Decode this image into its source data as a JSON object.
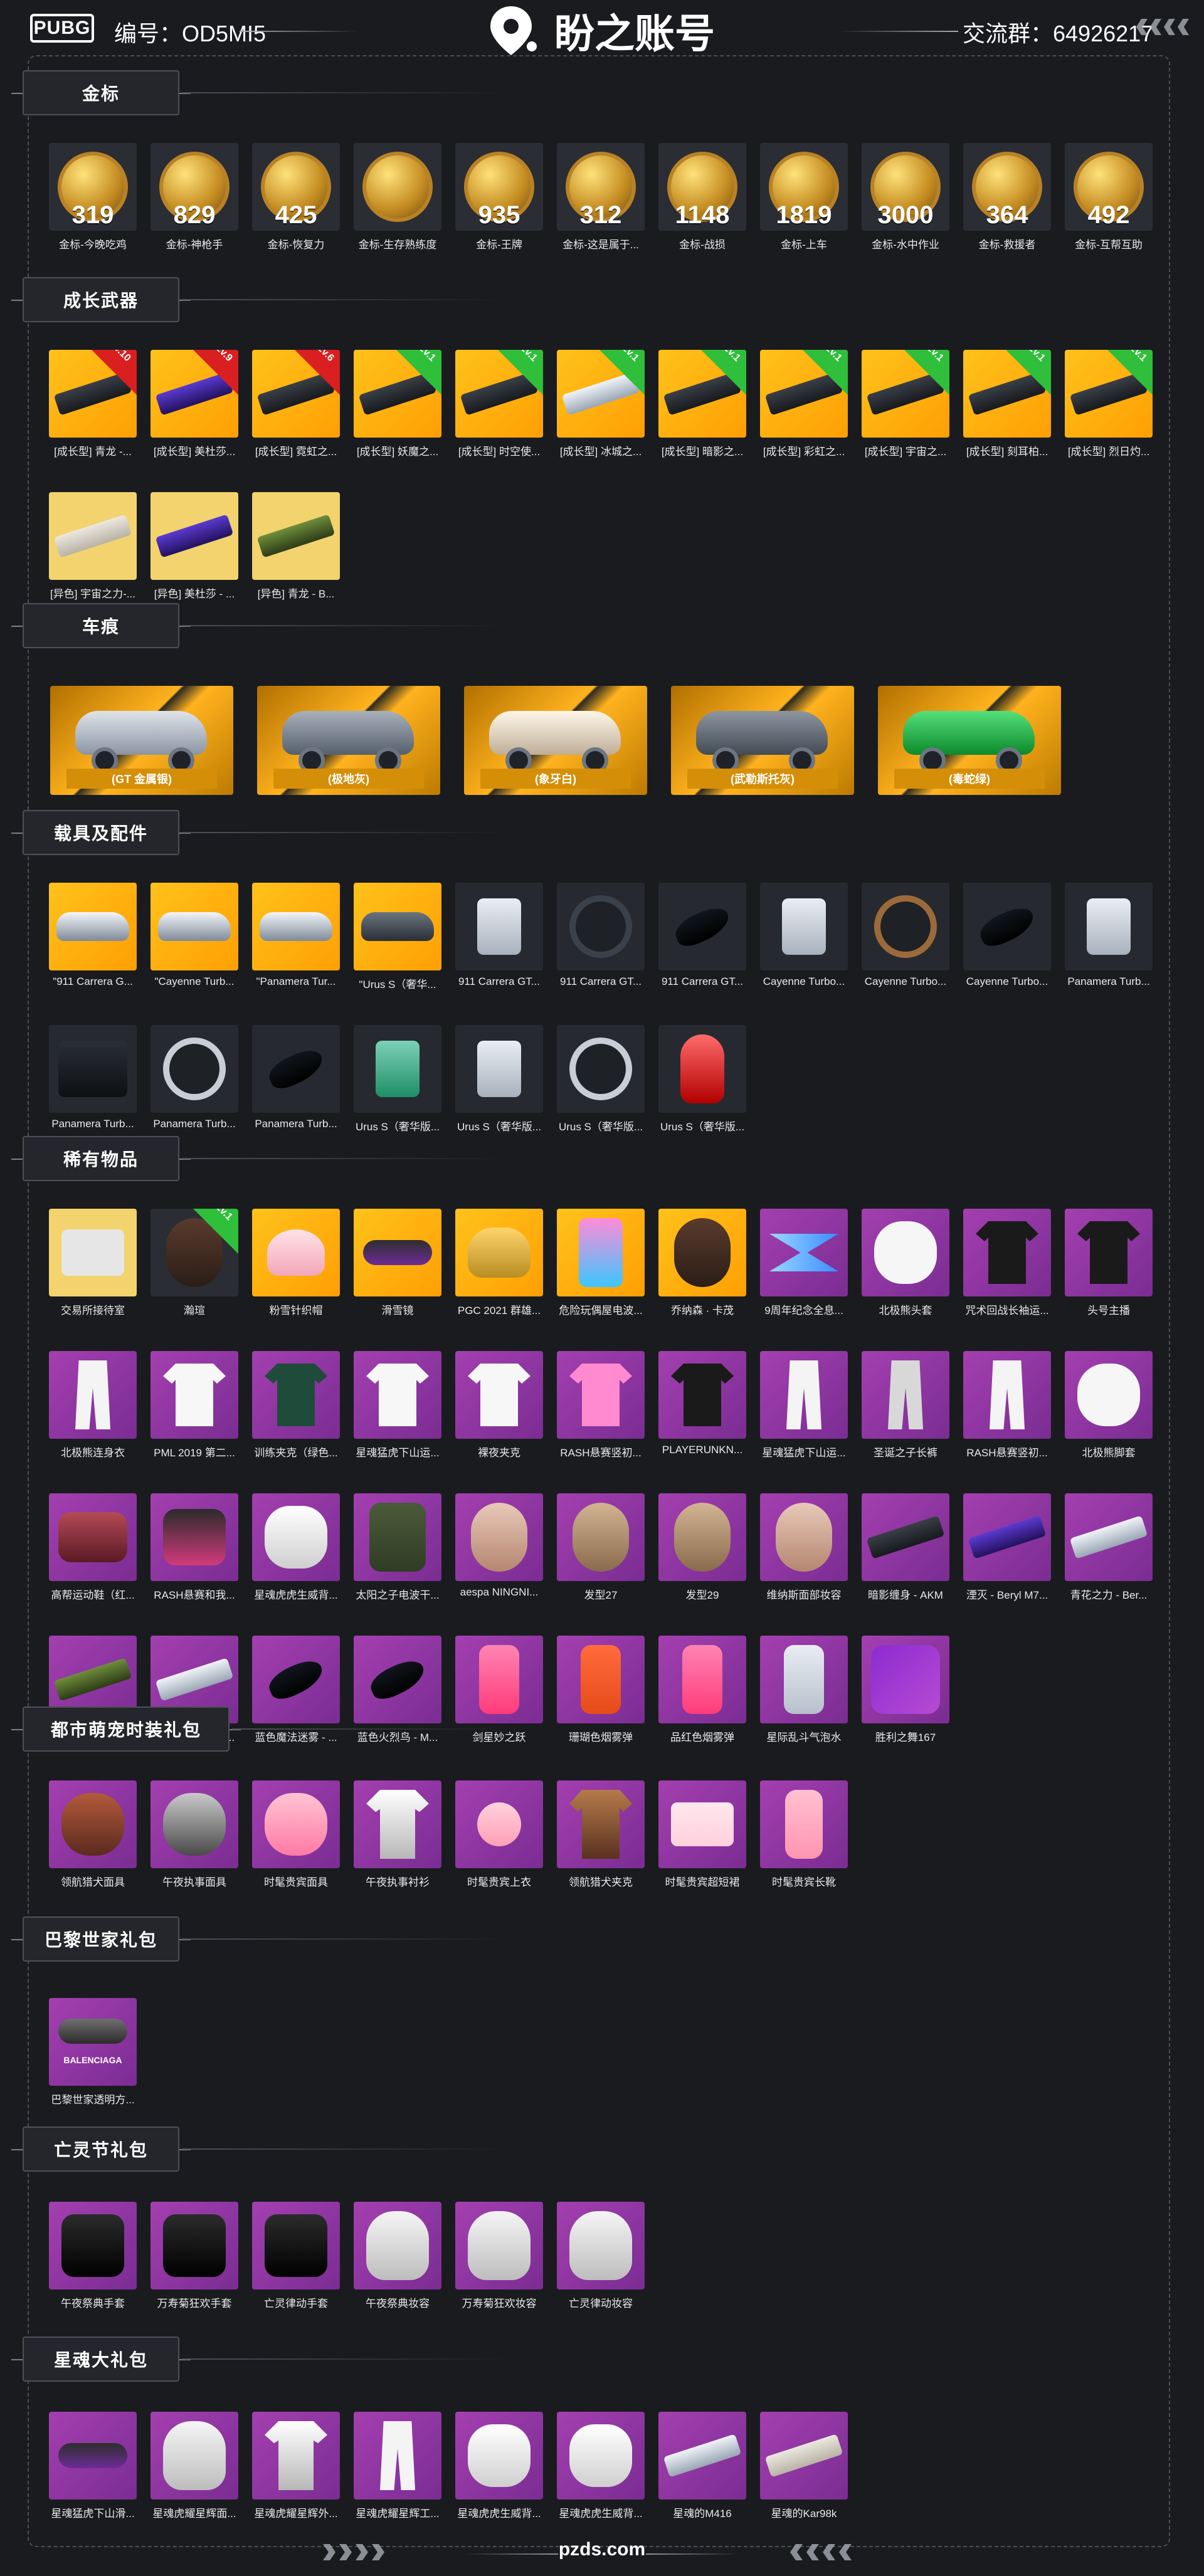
{
  "header": {
    "pubg_logo_text": "PUBG",
    "serial": "编号：OD5MI5",
    "brand_title": "盼之账号",
    "group": "交流群：64926217"
  },
  "sections": {
    "gold_badges": {
      "title": "金标",
      "items": [
        {
          "num": "319",
          "label": "金标-今晚吃鸡"
        },
        {
          "num": "829",
          "label": "金标-神枪手"
        },
        {
          "num": "425",
          "label": "金标-恢复力"
        },
        {
          "num": "",
          "label": "金标-生存熟练度"
        },
        {
          "num": "935",
          "label": "金标-王牌"
        },
        {
          "num": "312",
          "label": "金标-这是属于..."
        },
        {
          "num": "1148",
          "label": "金标-战损"
        },
        {
          "num": "1819",
          "label": "金标-上车"
        },
        {
          "num": "3000",
          "label": "金标-水中作业"
        },
        {
          "num": "364",
          "label": "金标-救援者"
        },
        {
          "num": "492",
          "label": "金标-互帮互助"
        }
      ]
    },
    "growth_weapons": {
      "title": "成长武器",
      "items": [
        {
          "label": "[成长型] 青龙 -...",
          "badge": "Lv.10",
          "badge_color": "red"
        },
        {
          "label": "[成长型] 美杜莎...",
          "badge": "Lv.9",
          "badge_color": "red"
        },
        {
          "label": "[成长型] 霓虹之...",
          "badge": "Lv.6",
          "badge_color": "red"
        },
        {
          "label": "[成长型] 妖魔之...",
          "badge": "Lv.1",
          "badge_color": "green"
        },
        {
          "label": "[成长型] 时空使...",
          "badge": "Lv.1",
          "badge_color": "green"
        },
        {
          "label": "[成长型] 冰城之...",
          "badge": "Lv.1",
          "badge_color": "green"
        },
        {
          "label": "[成长型] 暗影之...",
          "badge": "Lv.1",
          "badge_color": "green"
        },
        {
          "label": "[成长型] 彩虹之...",
          "badge": "Lv.1",
          "badge_color": "green"
        },
        {
          "label": "[成长型] 宇宙之...",
          "badge": "Lv.1",
          "badge_color": "green"
        },
        {
          "label": "[成长型] 刻耳柏...",
          "badge": "Lv.1",
          "badge_color": "green"
        },
        {
          "label": "[成长型] 烈日灼...",
          "badge": "Lv.1",
          "badge_color": "green"
        },
        {
          "label": "[异色] 宇宙之力-...",
          "badge": "",
          "badge_color": ""
        },
        {
          "label": "[异色] 美杜莎 - ...",
          "badge": "",
          "badge_color": ""
        },
        {
          "label": "[异色] 青龙 - B...",
          "badge": "",
          "badge_color": ""
        }
      ]
    },
    "vehicles": {
      "title": "车痕",
      "items": [
        {
          "label": "(GT 金属银)"
        },
        {
          "label": "(极地灰)"
        },
        {
          "label": "(象牙白)"
        },
        {
          "label": "(武勒斯托灰)"
        },
        {
          "label": "(毒蛇绿)"
        }
      ]
    },
    "vehicle_parts": {
      "title": "载具及配件",
      "items": [
        {
          "label": "\"911 Carrera G..."
        },
        {
          "label": "\"Cayenne Turb..."
        },
        {
          "label": "\"Panamera Tur..."
        },
        {
          "label": "\"Urus S（奢华..."
        },
        {
          "label": "911 Carrera GT..."
        },
        {
          "label": "911 Carrera GT..."
        },
        {
          "label": "911 Carrera GT..."
        },
        {
          "label": "Cayenne Turbo..."
        },
        {
          "label": "Cayenne Turbo..."
        },
        {
          "label": "Cayenne Turbo..."
        },
        {
          "label": "Panamera Turb..."
        },
        {
          "label": "Panamera Turb..."
        },
        {
          "label": "Panamera Turb..."
        },
        {
          "label": "Panamera Turb..."
        },
        {
          "label": "Urus S（奢华版..."
        },
        {
          "label": "Urus S（奢华版..."
        },
        {
          "label": "Urus S（奢华版..."
        },
        {
          "label": "Urus S（奢华版..."
        }
      ]
    },
    "rare_items": {
      "title": "稀有物品",
      "items": [
        {
          "label": "交易所接待室",
          "style": "pale"
        },
        {
          "label": "瀚瑄",
          "style": "dark",
          "badge": "Lv.1",
          "badge_color": "green"
        },
        {
          "label": "粉雪针织帽",
          "style": "gold"
        },
        {
          "label": "滑雪镜",
          "style": "gold"
        },
        {
          "label": "PGC 2021 群雄...",
          "style": "gold"
        },
        {
          "label": "危险玩偶屋电波...",
          "style": "gold"
        },
        {
          "label": "乔纳森 · 卡茂",
          "style": "gold"
        },
        {
          "label": "9周年纪念全息...",
          "style": "purple"
        },
        {
          "label": "北极熊头套",
          "style": "purple"
        },
        {
          "label": "咒术回战长袖运...",
          "style": "purple"
        },
        {
          "label": "头号主播",
          "style": "purple"
        },
        {
          "label": "北极熊连身衣",
          "style": "purple"
        },
        {
          "label": "PML 2019 第二...",
          "style": "purple"
        },
        {
          "label": "训练夹克（绿色...",
          "style": "purple"
        },
        {
          "label": "星魂猛虎下山运...",
          "style": "purple"
        },
        {
          "label": "裸夜夹克",
          "style": "purple"
        },
        {
          "label": "RASH悬赛竖初...",
          "style": "purple"
        },
        {
          "label": "PLAYERUNKN...",
          "style": "purple"
        },
        {
          "label": "星魂猛虎下山运...",
          "style": "purple"
        },
        {
          "label": "圣诞之子长裤",
          "style": "purple"
        },
        {
          "label": "RASH悬赛竖初...",
          "style": "purple"
        },
        {
          "label": "北极熊脚套",
          "style": "purple"
        },
        {
          "label": "高帮运动鞋（红...",
          "style": "purple"
        },
        {
          "label": "RASH悬赛和我...",
          "style": "purple"
        },
        {
          "label": "星魂虎虎生威背...",
          "style": "purple"
        },
        {
          "label": "太阳之子电波干...",
          "style": "purple"
        },
        {
          "label": "aespa NINGNI...",
          "style": "purple"
        },
        {
          "label": "发型27",
          "style": "purple"
        },
        {
          "label": "发型29",
          "style": "purple"
        },
        {
          "label": "维纳斯面部妆容",
          "style": "purple"
        },
        {
          "label": "暗影缠身 - AKM",
          "style": "purple"
        },
        {
          "label": "湮灭 - Beryl M7...",
          "style": "purple"
        },
        {
          "label": "青花之力 - Ber...",
          "style": "purple"
        },
        {
          "label": "毒性 - Beryl M7...",
          "style": "purple"
        },
        {
          "label": "青花之力 - Mini...",
          "style": "purple"
        },
        {
          "label": "蓝色魔法迷雾 - ...",
          "style": "purple"
        },
        {
          "label": "蓝色火烈鸟 - M...",
          "style": "purple"
        },
        {
          "label": "剑星妙之跃",
          "style": "purple"
        },
        {
          "label": "珊瑚色烟雾弹",
          "style": "purple"
        },
        {
          "label": "品红色烟雾弹",
          "style": "purple"
        },
        {
          "label": "星际乱斗气泡水",
          "style": "purple"
        },
        {
          "label": "胜利之舞167",
          "style": "purple"
        }
      ]
    },
    "urban_pet": {
      "title": "都市萌宠时装礼包",
      "items": [
        {
          "label": "领航猎犬面具"
        },
        {
          "label": "午夜执事面具"
        },
        {
          "label": "时髦贵宾面具"
        },
        {
          "label": "午夜执事衬衫"
        },
        {
          "label": "时髦贵宾上衣"
        },
        {
          "label": "领航猎犬夹克"
        },
        {
          "label": "时髦贵宾超短裙"
        },
        {
          "label": "时髦贵宾长靴"
        }
      ]
    },
    "paris_world": {
      "title": "巴黎世家礼包",
      "items": [
        {
          "label": "巴黎世家透明方...",
          "brand": "BALENCIAGA"
        }
      ]
    },
    "dead_day": {
      "title": "亡灵节礼包",
      "items": [
        {
          "label": "午夜祭典手套"
        },
        {
          "label": "万寿菊狂欢手套"
        },
        {
          "label": "亡灵律动手套"
        },
        {
          "label": "午夜祭典妆容"
        },
        {
          "label": "万寿菊狂欢妆容"
        },
        {
          "label": "亡灵律动妆容"
        }
      ]
    },
    "star_soul": {
      "title": "星魂大礼包",
      "items": [
        {
          "label": "星魂猛虎下山滑..."
        },
        {
          "label": "星魂虎耀星辉面..."
        },
        {
          "label": "星魂虎耀星辉外..."
        },
        {
          "label": "星魂虎耀星辉工..."
        },
        {
          "label": "星魂虎虎生威背..."
        },
        {
          "label": "星魂虎虎生威背..."
        },
        {
          "label": "星魂的M416"
        },
        {
          "label": "星魂的Kar98k"
        }
      ]
    }
  },
  "footer": {
    "site": "pzds.com"
  },
  "colors": {
    "background": "#1a1b1e",
    "gold": "#ffb21e",
    "purple": "#a43fb0",
    "green_badge": "#2fbf3a",
    "red_badge": "#d91f1f"
  }
}
